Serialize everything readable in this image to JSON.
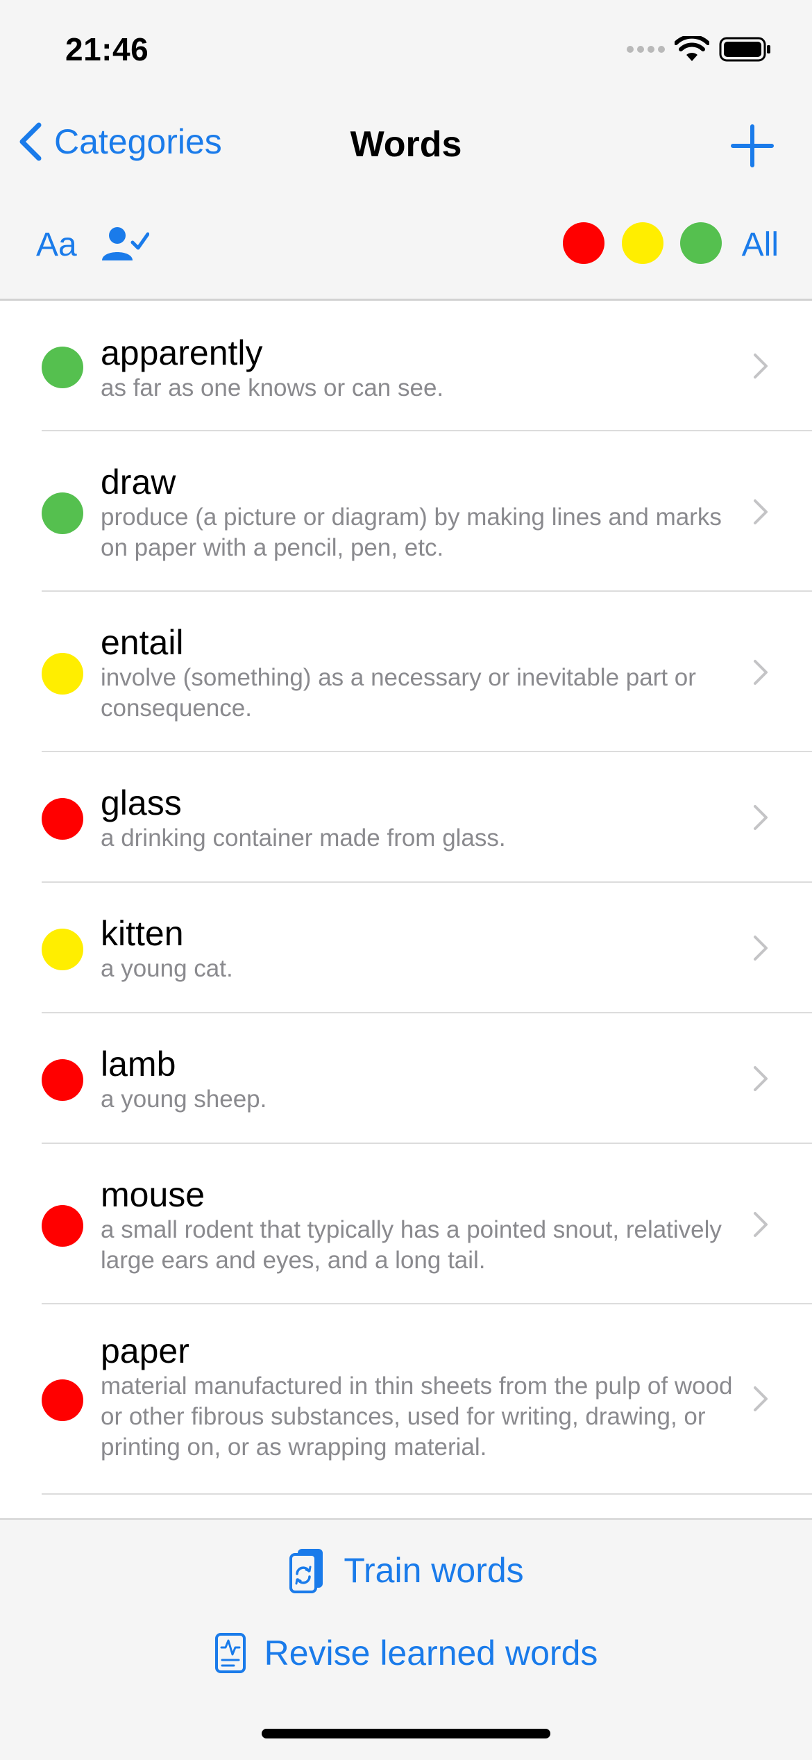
{
  "status_bar": {
    "time": "21:46"
  },
  "nav": {
    "back_label": "Categories",
    "title": "Words"
  },
  "toolbar": {
    "font_label": "Aa",
    "all_label": "All",
    "filters": [
      {
        "name": "red",
        "color": "#ff0000"
      },
      {
        "name": "yellow",
        "color": "#ffee00"
      },
      {
        "name": "green",
        "color": "#55c04f"
      }
    ]
  },
  "colors": {
    "accent": "#1a7bea",
    "red": "#ff0000",
    "yellow": "#ffee00",
    "green": "#55c04f"
  },
  "words": [
    {
      "word": "apparently",
      "definition": "as far as one knows or can see.",
      "status": "green"
    },
    {
      "word": "draw",
      "definition": "produce (a picture or diagram) by making lines and marks on paper with a pencil, pen, etc.",
      "status": "green"
    },
    {
      "word": "entail",
      "definition": "involve (something) as a necessary or inevitable part or consequence.",
      "status": "yellow"
    },
    {
      "word": "glass",
      "definition": "a drinking container made from glass.",
      "status": "red"
    },
    {
      "word": "kitten",
      "definition": "a young cat.",
      "status": "yellow"
    },
    {
      "word": "lamb",
      "definition": "a young sheep.",
      "status": "red"
    },
    {
      "word": "mouse",
      "definition": "a small rodent that typically has a pointed snout, relatively large ears and eyes, and a long tail.",
      "status": "red"
    },
    {
      "word": "paper",
      "definition": "material manufactured in thin sheets from the pulp of wood or other fibrous substances, used for writing, drawing, or printing on, or as wrapping material.",
      "status": "red"
    }
  ],
  "bottom": {
    "train_label": "Train words",
    "revise_label": "Revise learned words"
  }
}
